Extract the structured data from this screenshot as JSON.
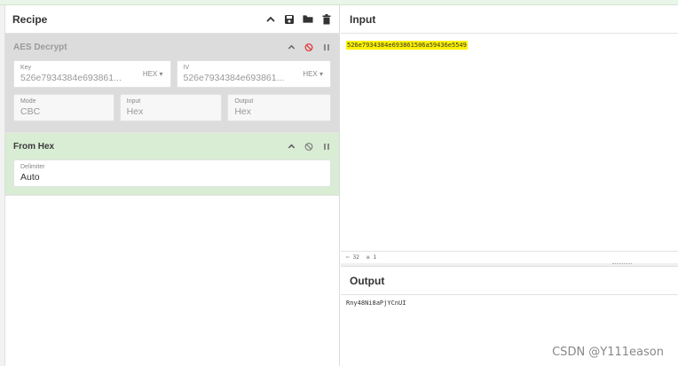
{
  "recipe": {
    "title": "Recipe",
    "icons": [
      "chevron-up-icon",
      "save-icon",
      "folder-icon",
      "trash-icon"
    ]
  },
  "operations": [
    {
      "title": "AES Decrypt",
      "disabled": true,
      "key_label": "Key",
      "key_value": "526e7934384e693861...",
      "key_format": "HEX ▾",
      "iv_label": "IV",
      "iv_value": "526e7934384e693861...",
      "iv_format": "HEX ▾",
      "mode_label": "Mode",
      "mode_value": "CBC",
      "input_label": "Input",
      "input_value": "Hex",
      "output_label": "Output",
      "output_value": "Hex"
    },
    {
      "title": "From Hex",
      "disabled": false,
      "delimiter_label": "Delimiter",
      "delimiter_value": "Auto"
    }
  ],
  "input": {
    "title": "Input",
    "text": "526e7934384e693861506a59436e5549"
  },
  "status": {
    "length": "32",
    "lines": "1"
  },
  "output": {
    "title": "Output",
    "text": "Rny48Ni8aPjYCnUI"
  },
  "watermark": "CSDN @Y111eason",
  "colors": {
    "disabled_op_bg": "#dcdcdc",
    "active_op_bg": "#d9ecd4",
    "highlight": "#fff200",
    "disable_icon": "#e0343a"
  }
}
